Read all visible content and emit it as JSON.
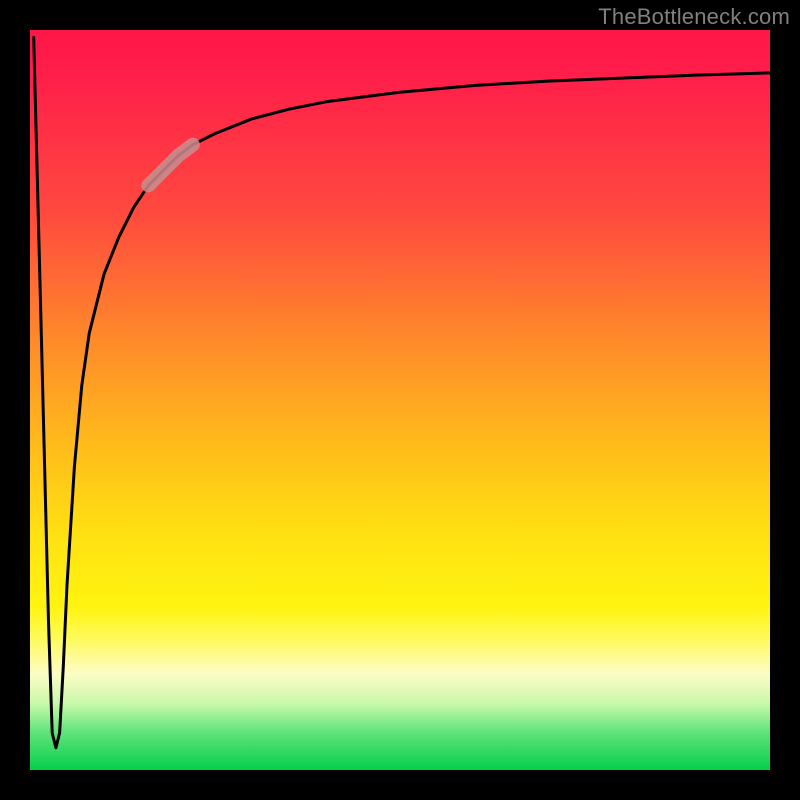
{
  "attribution": "TheBottleneck.com",
  "colors": {
    "frame": "#000000",
    "curve": "#000000",
    "highlight": "#c98e8e",
    "gradient_stops": [
      "#ff1648",
      "#ff4a3e",
      "#ff8a2a",
      "#ffb81c",
      "#ffe012",
      "#fff410",
      "#fdfcc6",
      "#05cf4b"
    ]
  },
  "chart_data": {
    "type": "line",
    "title": "",
    "xlabel": "",
    "ylabel": "",
    "xlim": [
      0,
      100
    ],
    "ylim": [
      0,
      100
    ],
    "grid": false,
    "series": [
      {
        "name": "bottleneck-curve",
        "x": [
          0.5,
          1.5,
          2.5,
          3,
          3.5,
          4,
          4.5,
          5,
          6,
          7,
          8,
          10,
          12,
          14,
          16,
          18,
          20,
          22,
          25,
          30,
          35,
          40,
          50,
          60,
          70,
          80,
          90,
          100
        ],
        "y": [
          99,
          60,
          20,
          5,
          3,
          5,
          14,
          25,
          41,
          52,
          59,
          67,
          72,
          76,
          79,
          81,
          83,
          84.5,
          86,
          88,
          89.3,
          90.3,
          91.6,
          92.5,
          93.1,
          93.5,
          93.9,
          94.2
        ]
      }
    ],
    "annotations": [
      {
        "name": "highlight-segment",
        "series": "bottleneck-curve",
        "x_range": [
          16,
          22
        ],
        "style": "thick-muted"
      }
    ]
  }
}
